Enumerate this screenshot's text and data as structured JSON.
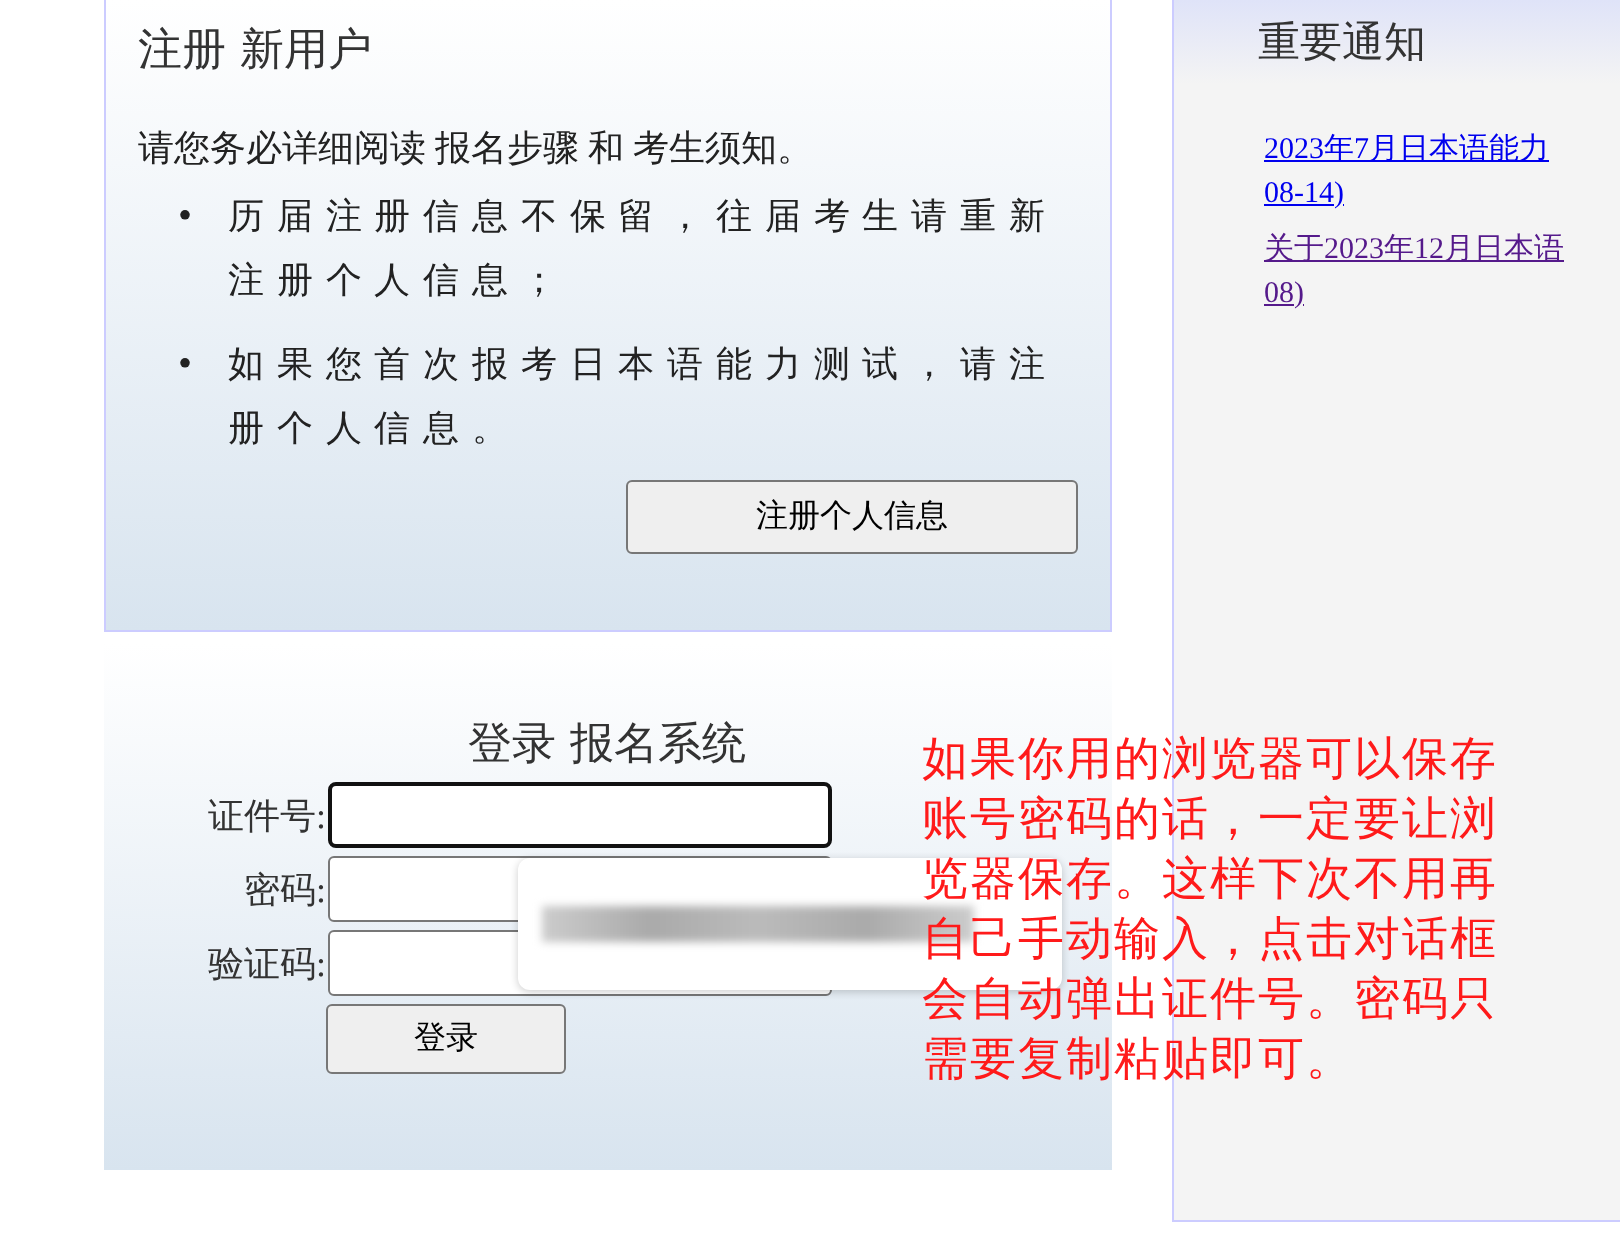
{
  "register": {
    "title": "注册 新用户",
    "intro": "请您务必详细阅读 报名步骤 和 考生须知。",
    "notes": [
      {
        "bullet": "•",
        "text": "历届注册信息不保留，往届考生请重新注册个人信息；"
      },
      {
        "bullet": "•",
        "text": "如果您首次报考日本语能力测试，请注册个人信息。"
      }
    ],
    "button": "注册个人信息"
  },
  "login": {
    "title": "登录 报名系统",
    "fields": [
      {
        "label": "证件号:",
        "focused": true
      },
      {
        "label": "密码:",
        "focused": false
      },
      {
        "label": "验证码:",
        "focused": false
      }
    ],
    "button": "登录"
  },
  "annotation": "如果你用的浏览器可以保存账号密码的话，一定要让浏览器保存。这样下次不用再自己手动输入，点击对话框会自动弹出证件号。密码只需要复制粘贴即可。",
  "notices": {
    "title": "重要通知",
    "links": [
      {
        "lines": [
          "2023年7月日本语能力",
          "08-14)"
        ],
        "visited": false
      },
      {
        "lines": [
          "关于2023年12月日本语",
          "08)"
        ],
        "visited": true
      }
    ]
  }
}
